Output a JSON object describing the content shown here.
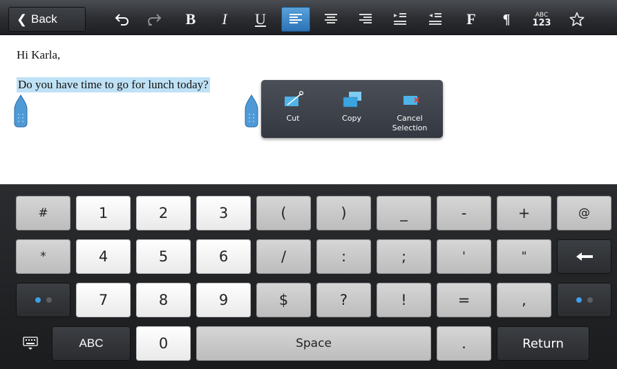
{
  "toolbar": {
    "back_label": "Back",
    "bold_label": "B",
    "italic_label": "I",
    "underline_label": "U",
    "font_label": "F",
    "paragraph_label": "¶",
    "abc_top": "ABC",
    "abc_bottom": "123"
  },
  "document": {
    "greeting": "Hi Karla,",
    "selected_text": "Do you have time to go for lunch today?"
  },
  "context_menu": {
    "cut": "Cut",
    "copy": "Copy",
    "cancel_line1": "Cancel",
    "cancel_line2": "Selection"
  },
  "keyboard": {
    "row1": [
      "#",
      "1",
      "2",
      "3",
      "(",
      ")",
      "_",
      "-",
      "+",
      "@"
    ],
    "row2": [
      "*",
      "4",
      "5",
      "6",
      "/",
      ":",
      ";",
      "'",
      "\""
    ],
    "row3": [
      "7",
      "8",
      "9",
      "$",
      "?",
      "!",
      "=",
      ","
    ],
    "abc": "ABC",
    "zero": "0",
    "space": "Space",
    "period": ".",
    "return": "Return"
  },
  "colors": {
    "selection": "#bfe1f5",
    "accent": "#2a72b5"
  }
}
